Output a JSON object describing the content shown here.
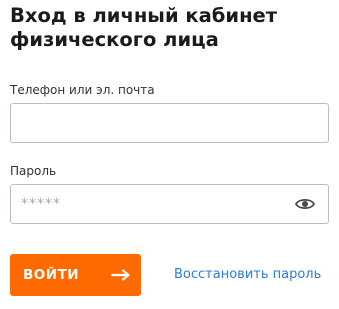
{
  "form": {
    "title": "Вход в личный кабинет физического лица",
    "phone_label": "Телефон или эл. почта",
    "phone_value": "",
    "phone_placeholder": "",
    "password_label": "Пароль",
    "password_value": "",
    "password_placeholder": "*****",
    "show_password_icon": "eye-icon",
    "login_label": "ВОЙТИ",
    "login_icon": "arrow-right-icon",
    "restore_label": "Восстановить пароль"
  },
  "colors": {
    "accent": "#ff6a00",
    "link": "#2b7bd4",
    "input_border": "#b9bec6",
    "title": "#1b1b1b"
  }
}
